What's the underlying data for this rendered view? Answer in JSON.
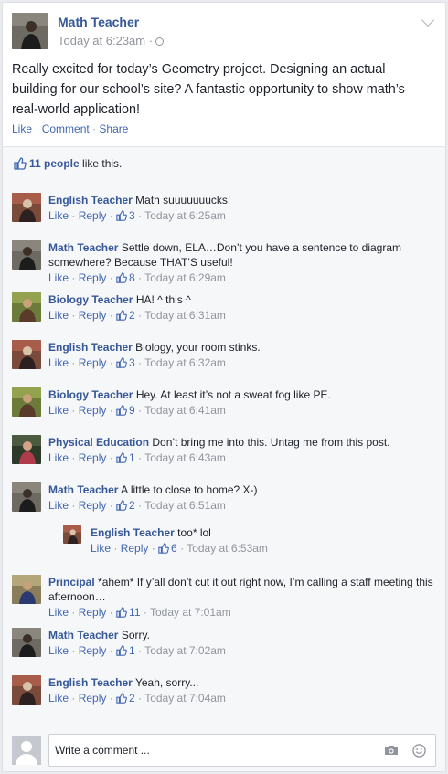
{
  "post": {
    "author": "Math Teacher",
    "time": "Today at 6:23am ·",
    "text": "Really excited for today’s Geometry project. Designing an actual building for our school’s site? A fantastic opportunity to show math’s real-world application!",
    "actions": {
      "like": "Like",
      "comment": "Comment",
      "share": "Share"
    }
  },
  "likes": {
    "count_text": "11 people",
    "suffix": "like this."
  },
  "comments": [
    {
      "author": "English Teacher",
      "text": "Math suuuuuuucks!",
      "likes": "3",
      "time": "Today at 6:25am",
      "avatar": "english"
    },
    {
      "author": "Math Teacher",
      "text": "Settle down, ELA…Don’t you have a sentence to diagram somewhere? Because THAT’S useful!",
      "likes": "8",
      "time": "Today at 6:29am",
      "avatar": "math"
    },
    {
      "author": "Biology Teacher",
      "text": "HA! ^ this ^",
      "likes": "2",
      "time": "Today at 6:31am",
      "avatar": "biology"
    },
    {
      "author": "English Teacher",
      "text": "Biology, your room stinks.",
      "likes": "3",
      "time": "Today at 6:32am",
      "avatar": "english"
    },
    {
      "author": "Biology Teacher",
      "text": "Hey. At least it’s not a sweat fog like PE.",
      "likes": "9",
      "time": "Today at 6:41am",
      "avatar": "biology"
    },
    {
      "author": "Physical Education",
      "text": "Don’t bring me into this. Untag me from this post.",
      "likes": "1",
      "time": "Today at 6:43am",
      "avatar": "pe"
    },
    {
      "author": "Math Teacher",
      "text": "A little to close to home? X-)",
      "likes": "2",
      "time": "Today at 6:51am",
      "avatar": "math"
    }
  ],
  "reply": {
    "author": "English Teacher",
    "text": "too* lol",
    "likes": "6",
    "time": "Today at 6:53am",
    "avatar": "english"
  },
  "comments2": [
    {
      "author": "Principal",
      "text": "*ahem* If y’all don’t cut it out right now, I’m calling a staff meeting this afternoon…",
      "likes": "11",
      "time": "Today at 7:01am",
      "avatar": "principal"
    },
    {
      "author": "Math Teacher",
      "text": "Sorry.",
      "likes": "1",
      "time": "Today at 7:02am",
      "avatar": "math"
    },
    {
      "author": "English Teacher",
      "text": "Yeah, sorry...",
      "likes": "2",
      "time": "Today at 7:04am",
      "avatar": "english"
    }
  ],
  "comment_actions": {
    "like": "Like",
    "reply": "Reply"
  },
  "composer": {
    "placeholder": "Write a comment ..."
  },
  "icons": {
    "globe": "globe-icon",
    "chevron": "chevron-down-icon",
    "thumb": "thumbs-up-icon",
    "camera": "camera-icon",
    "smile": "smiley-icon"
  },
  "colors": {
    "link": "#365899",
    "action": "#4267b2",
    "muted": "#90949c",
    "bg": "#f6f7f9"
  }
}
